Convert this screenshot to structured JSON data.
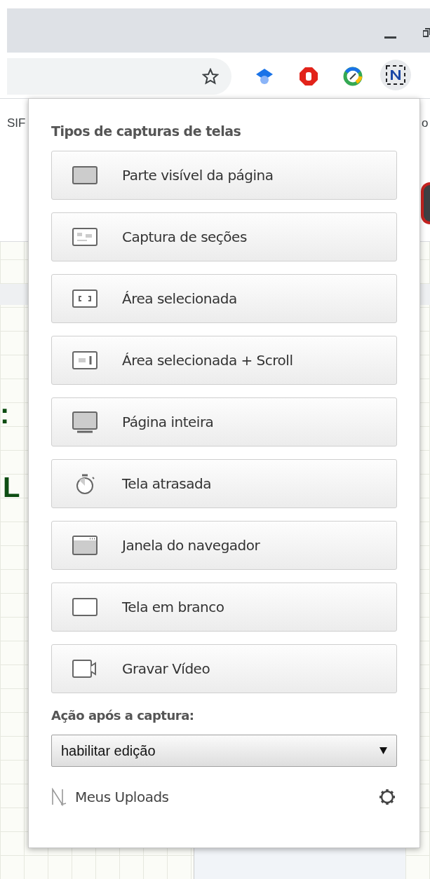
{
  "browser": {
    "bookmarks_left": "SIF",
    "bookmarks_right": "o",
    "page_fragments": [
      ":",
      "L"
    ]
  },
  "popup": {
    "title": "Tipos de capturas de telas",
    "options": [
      {
        "kind": "visible",
        "label": "Parte visível da página"
      },
      {
        "kind": "sections",
        "label": "Captura de seções"
      },
      {
        "kind": "area",
        "label": "Área selecionada"
      },
      {
        "kind": "area-scroll",
        "label": "Área selecionada + Scroll"
      },
      {
        "kind": "full",
        "label": "Página inteira"
      },
      {
        "kind": "timer",
        "label": "Tela atrasada"
      },
      {
        "kind": "window",
        "label": "Janela do navegador"
      },
      {
        "kind": "blank",
        "label": "Tela em branco"
      },
      {
        "kind": "video",
        "label": "Gravar Vídeo"
      }
    ],
    "after_label": "Ação após a captura:",
    "after_select": {
      "value": "habilitar edição"
    },
    "uploads_link": "Meus Uploads"
  }
}
